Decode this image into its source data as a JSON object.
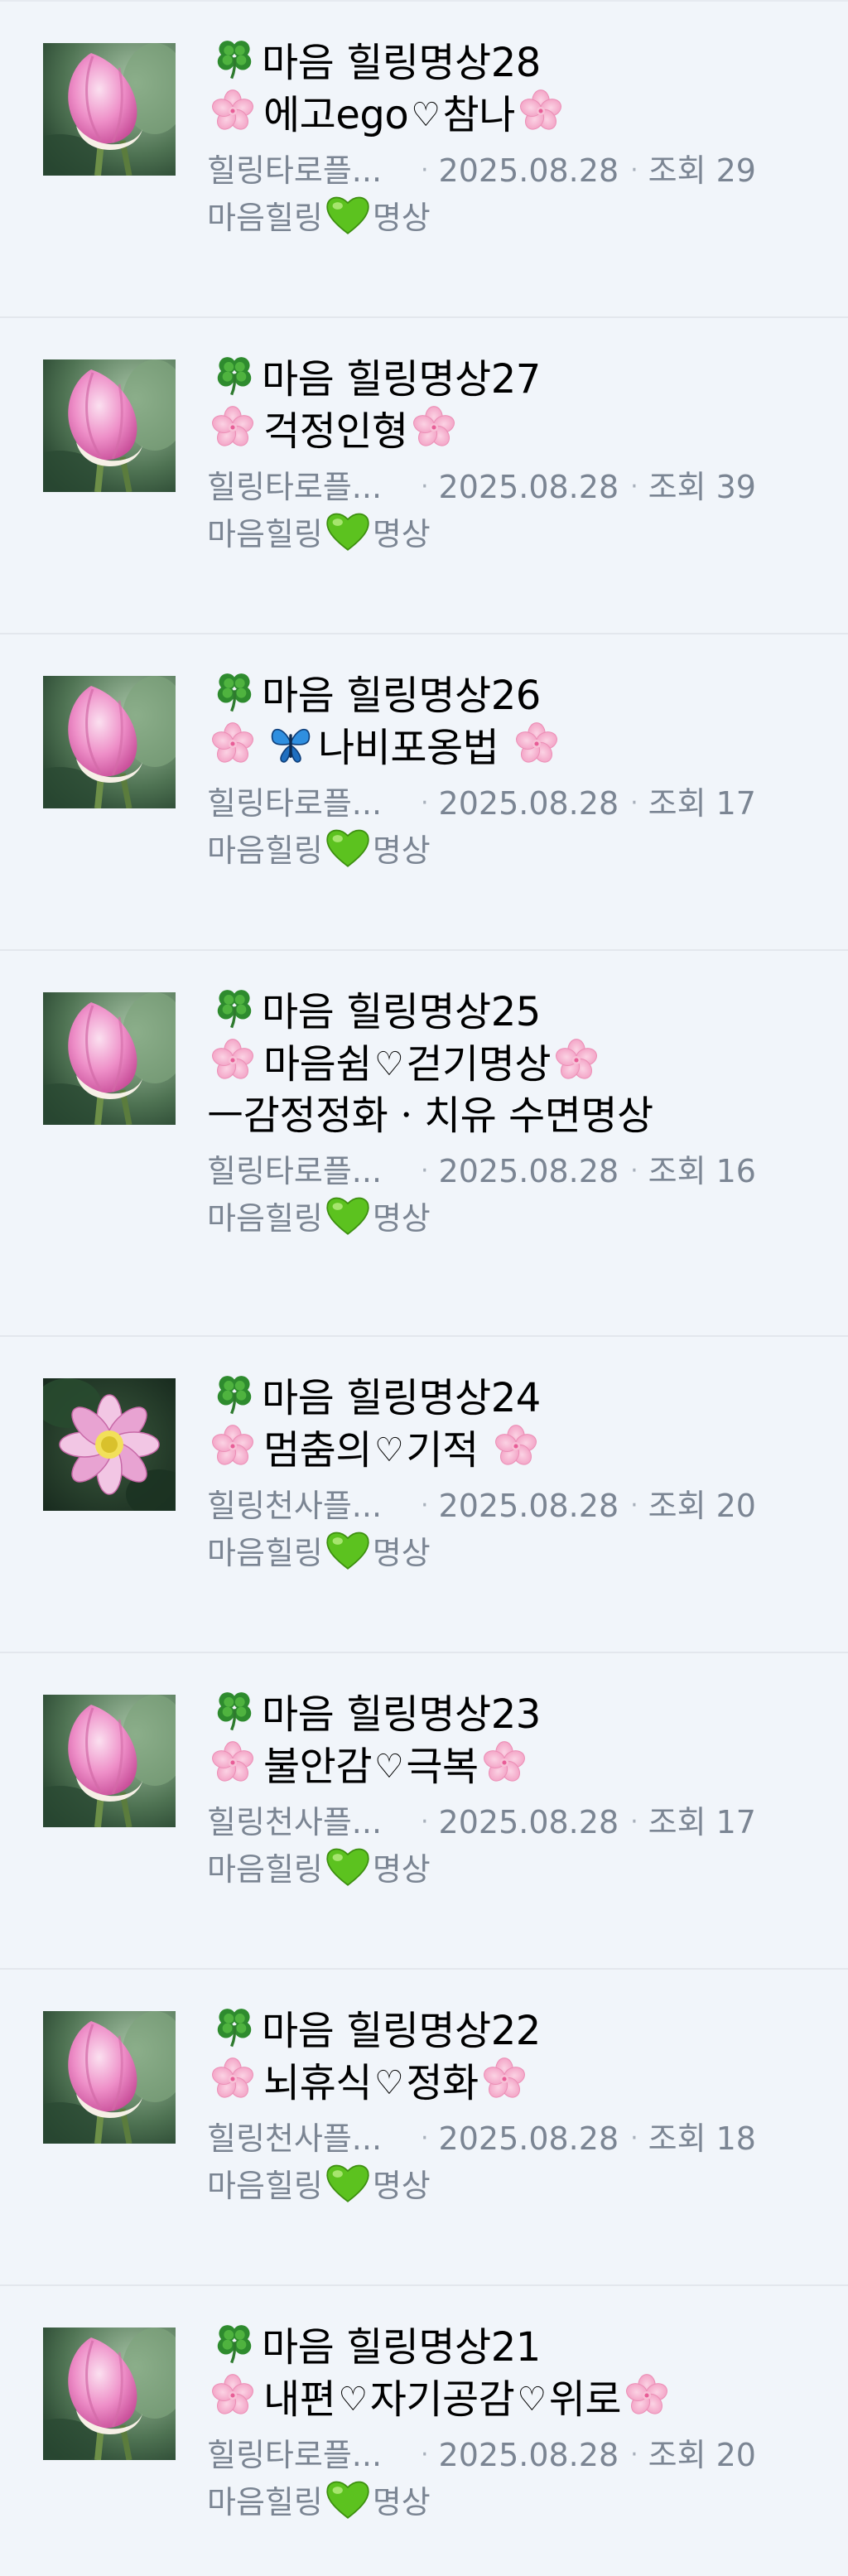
{
  "posts": [
    {
      "series": "마음 힐링명상28",
      "lines": [
        [
          {
            "t": "blossom"
          },
          {
            "t": "text",
            "v": "에고ego"
          },
          {
            "t": "heart"
          },
          {
            "t": "text",
            "v": "참나"
          },
          {
            "t": "blossom"
          }
        ]
      ],
      "author": "힐링타로플...",
      "date": "2025.08.28",
      "views_label": "조회",
      "views": "29",
      "category_a": "마음힐링",
      "category_b": "명상",
      "thumbnail": "lotus-bud-icon"
    },
    {
      "series": "마음 힐링명상27",
      "lines": [
        [
          {
            "t": "blossom"
          },
          {
            "t": "text",
            "v": "걱정인형"
          },
          {
            "t": "blossom"
          }
        ]
      ],
      "author": "힐링타로플...",
      "date": "2025.08.28",
      "views_label": "조회",
      "views": "39",
      "category_a": "마음힐링",
      "category_b": "명상",
      "thumbnail": "lotus-bud-icon"
    },
    {
      "series": "마음 힐링명상26",
      "lines": [
        [
          {
            "t": "blossom"
          },
          {
            "t": "butterfly"
          },
          {
            "t": "text",
            "v": "나비포옹법 "
          },
          {
            "t": "blossom"
          }
        ]
      ],
      "author": "힐링타로플...",
      "date": "2025.08.28",
      "views_label": "조회",
      "views": "17",
      "category_a": "마음힐링",
      "category_b": "명상",
      "thumbnail": "lotus-bud-icon"
    },
    {
      "series": "마음 힐링명상25",
      "lines": [
        [
          {
            "t": "blossom"
          },
          {
            "t": "text",
            "v": "마음쉼"
          },
          {
            "t": "heart"
          },
          {
            "t": "text",
            "v": "걷기명상"
          },
          {
            "t": "blossom"
          }
        ],
        [
          {
            "t": "text",
            "v": "ㅡ감정정화ㆍ치유 수면명상"
          }
        ]
      ],
      "author": "힐링타로플...",
      "date": "2025.08.28",
      "views_label": "조회",
      "views": "16",
      "category_a": "마음힐링",
      "category_b": "명상",
      "thumbnail": "lotus-bud-icon"
    },
    {
      "series": "마음 힐링명상24",
      "lines": [
        [
          {
            "t": "blossom"
          },
          {
            "t": "text",
            "v": "멈춤의"
          },
          {
            "t": "heart"
          },
          {
            "t": "text",
            "v": "기적 "
          },
          {
            "t": "blossom"
          }
        ]
      ],
      "author": "힐링천사플...",
      "date": "2025.08.28",
      "views_label": "조회",
      "views": "20",
      "category_a": "마음힐링",
      "category_b": "명상",
      "thumbnail": "lotus-bloom-icon"
    },
    {
      "series": "마음 힐링명상23",
      "lines": [
        [
          {
            "t": "blossom"
          },
          {
            "t": "text",
            "v": "불안감"
          },
          {
            "t": "heart"
          },
          {
            "t": "text",
            "v": "극복"
          },
          {
            "t": "blossom"
          }
        ]
      ],
      "author": "힐링천사플...",
      "date": "2025.08.28",
      "views_label": "조회",
      "views": "17",
      "category_a": "마음힐링",
      "category_b": "명상",
      "thumbnail": "lotus-bud-icon"
    },
    {
      "series": "마음 힐링명상22",
      "lines": [
        [
          {
            "t": "blossom"
          },
          {
            "t": "text",
            "v": "뇌휴식"
          },
          {
            "t": "heart"
          },
          {
            "t": "text",
            "v": "정화"
          },
          {
            "t": "blossom"
          }
        ]
      ],
      "author": "힐링천사플...",
      "date": "2025.08.28",
      "views_label": "조회",
      "views": "18",
      "category_a": "마음힐링",
      "category_b": "명상",
      "thumbnail": "lotus-bud-icon"
    },
    {
      "series": "마음 힐링명상21",
      "lines": [
        [
          {
            "t": "blossom"
          },
          {
            "t": "text",
            "v": "내편"
          },
          {
            "t": "heart"
          },
          {
            "t": "text",
            "v": "자기공감"
          },
          {
            "t": "heart"
          },
          {
            "t": "text",
            "v": "위로"
          },
          {
            "t": "blossom"
          }
        ]
      ],
      "author": "힐링타로플...",
      "date": "2025.08.28",
      "views_label": "조회",
      "views": "20",
      "category_a": "마음힐링",
      "category_b": "명상",
      "thumbnail": "lotus-bud-icon"
    }
  ],
  "glyphs": {
    "heart_char": "♡"
  },
  "colors": {
    "background": "#f1f5fa",
    "meta_text": "#7b8593",
    "divider": "#e3e7ed"
  }
}
